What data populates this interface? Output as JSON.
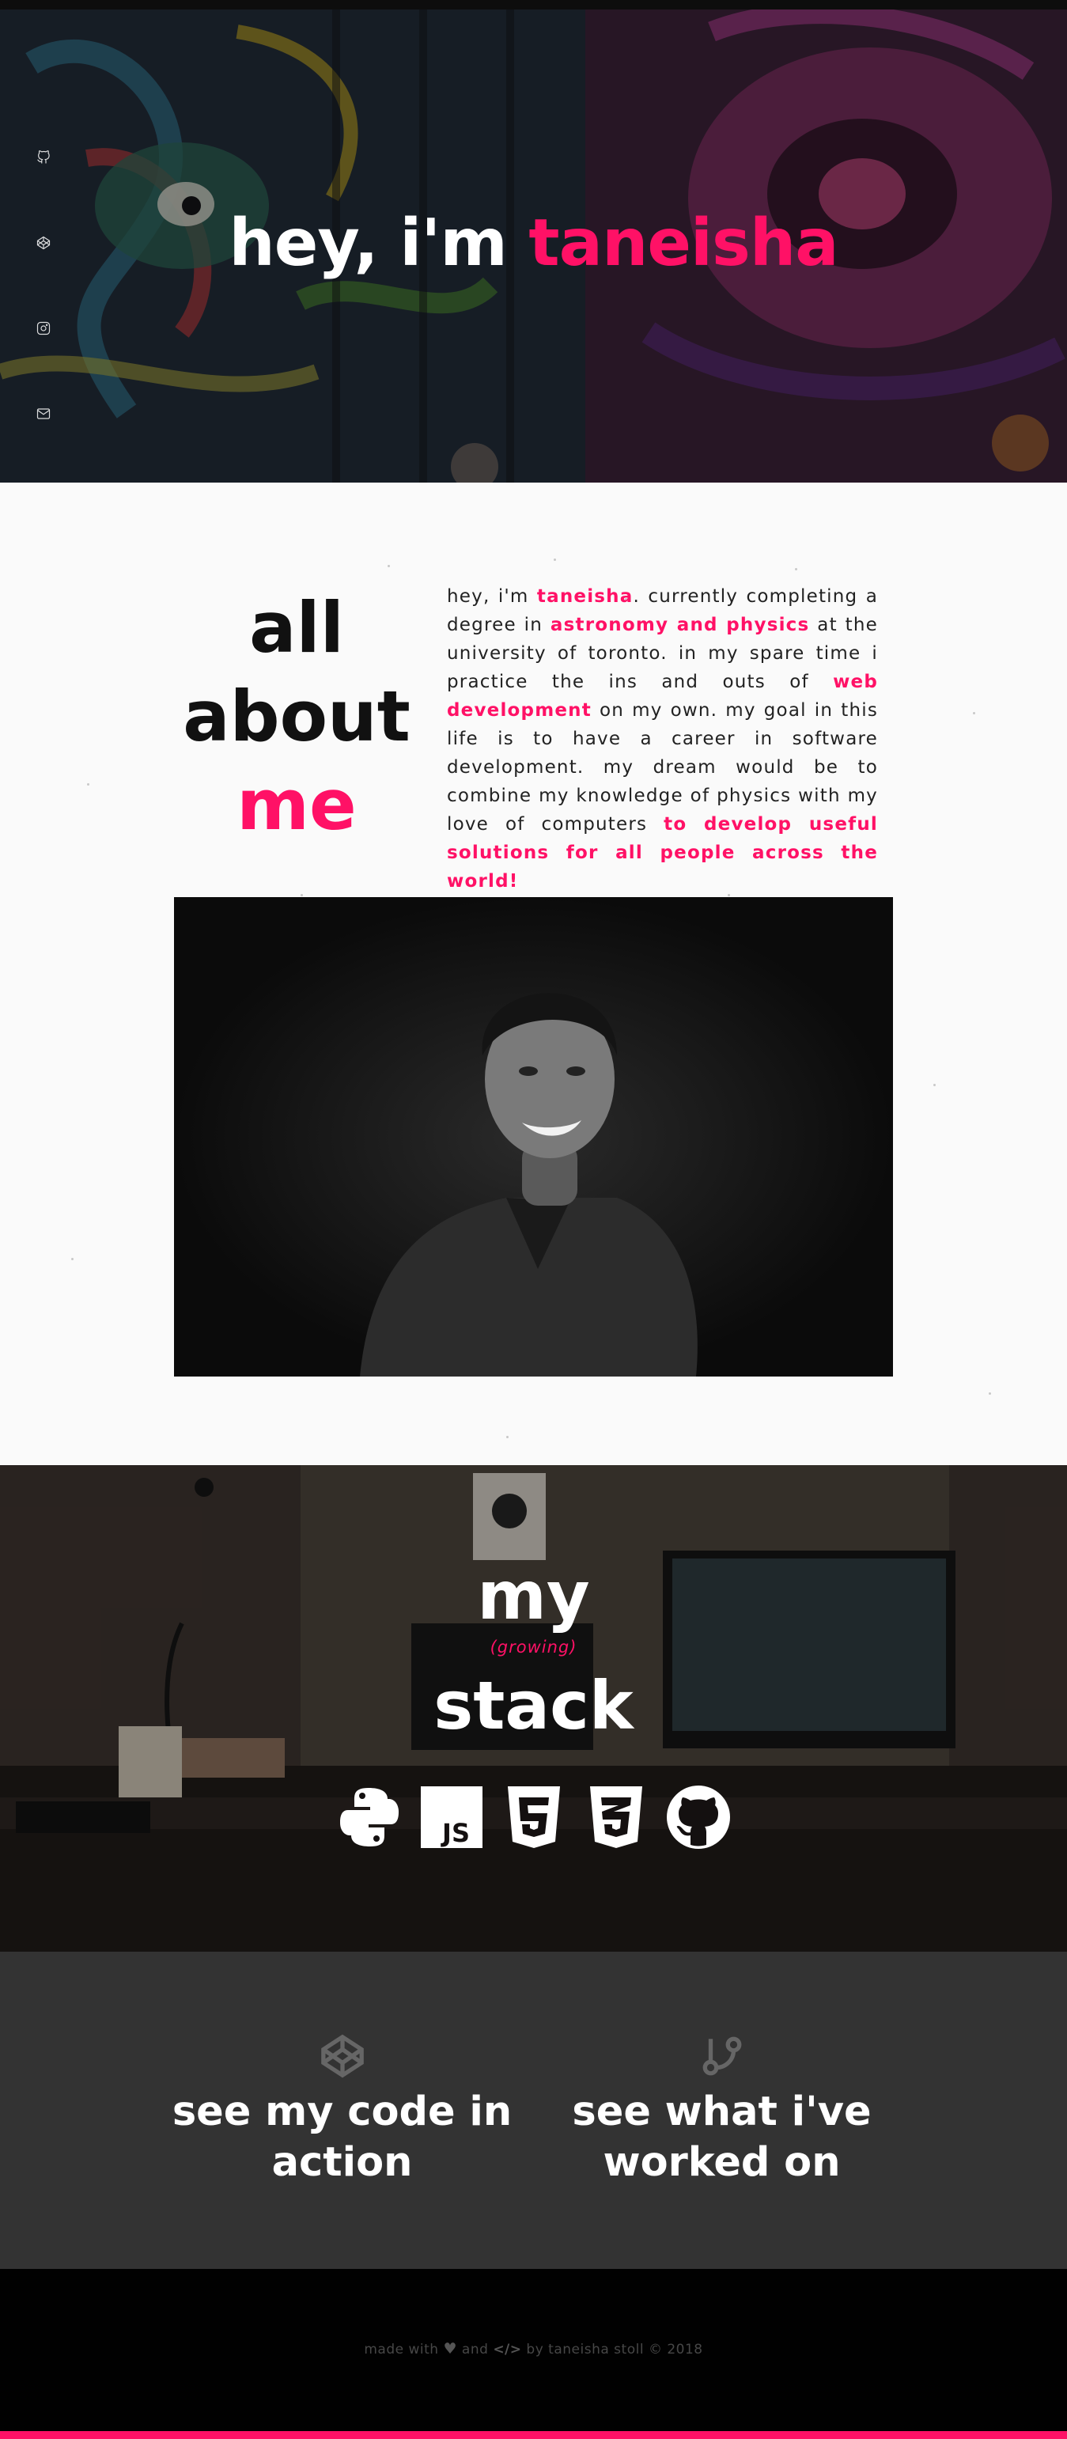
{
  "hero": {
    "title_prefix": "hey, i'm ",
    "title_name": "taneisha",
    "social_icons": [
      "github-icon",
      "codepen-icon",
      "instagram-icon",
      "email-icon"
    ]
  },
  "about": {
    "heading_line1": "all",
    "heading_line2": "about",
    "heading_line3": "me",
    "text": {
      "p1": "hey, i'm ",
      "name": "taneisha",
      "p2": ". currently completing a degree in ",
      "field": "astronomy and physics",
      "p3": " at the university of toronto. in my spare time i practice the ins and outs of ",
      "hobby": "web development",
      "p4": " on my own. my goal in this life is to have a career in software development. my dream would be to combine my knowledge of physics with my love of computers ",
      "dream": "to develop useful solutions for all people across the world!"
    }
  },
  "stack": {
    "word1": "my",
    "subtitle": "(growing)",
    "word2": "stack",
    "icons": [
      "python-icon",
      "javascript-icon",
      "html5-icon",
      "css3-icon",
      "github-icon"
    ]
  },
  "links": {
    "code": "see my code in action",
    "work": "see what i've worked on"
  },
  "footer": {
    "made_with": "made with",
    "and": "and",
    "by": "by taneisha stoll © 2018"
  },
  "colors": {
    "accent": "#ff1166",
    "links_bg": "#333333",
    "footer_bg": "#010101"
  }
}
